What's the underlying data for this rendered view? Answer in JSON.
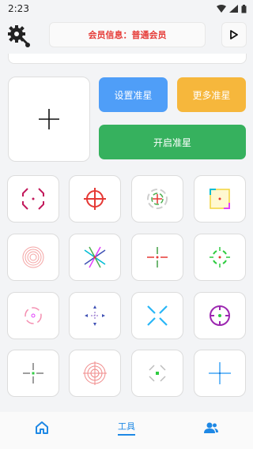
{
  "status": {
    "time": "2:23"
  },
  "header": {
    "member_text": "会员信息：普通会员",
    "gear_icon": "gear-wrench-icon",
    "play_icon": "play-icon"
  },
  "actions": {
    "set_label": "设置准星",
    "more_label": "更多准星",
    "open_label": "开启准星"
  },
  "crosshairs": [
    "crosshair-broken-octagon",
    "crosshair-circle-cross",
    "crosshair-rainbow-ring",
    "crosshair-bracket-square",
    "crosshair-concentric-rings",
    "crosshair-multicolor-x",
    "crosshair-rg-plus",
    "crosshair-green-bracket-circle",
    "crosshair-pink-circle",
    "crosshair-blue-arrows",
    "crosshair-cyan-x",
    "crosshair-purple-circle",
    "crosshair-gray-gap-cross",
    "crosshair-red-target",
    "crosshair-gray-diamond",
    "crosshair-blue-thin-cross"
  ],
  "nav": {
    "tools_label": "工具",
    "active": "tools",
    "colors": {
      "active": "#1e88e5"
    }
  },
  "colors": {
    "accent_blue": "#4f9ef8",
    "accent_orange": "#f6b73c",
    "accent_green": "#36b15e",
    "member_red": "#e53935"
  }
}
